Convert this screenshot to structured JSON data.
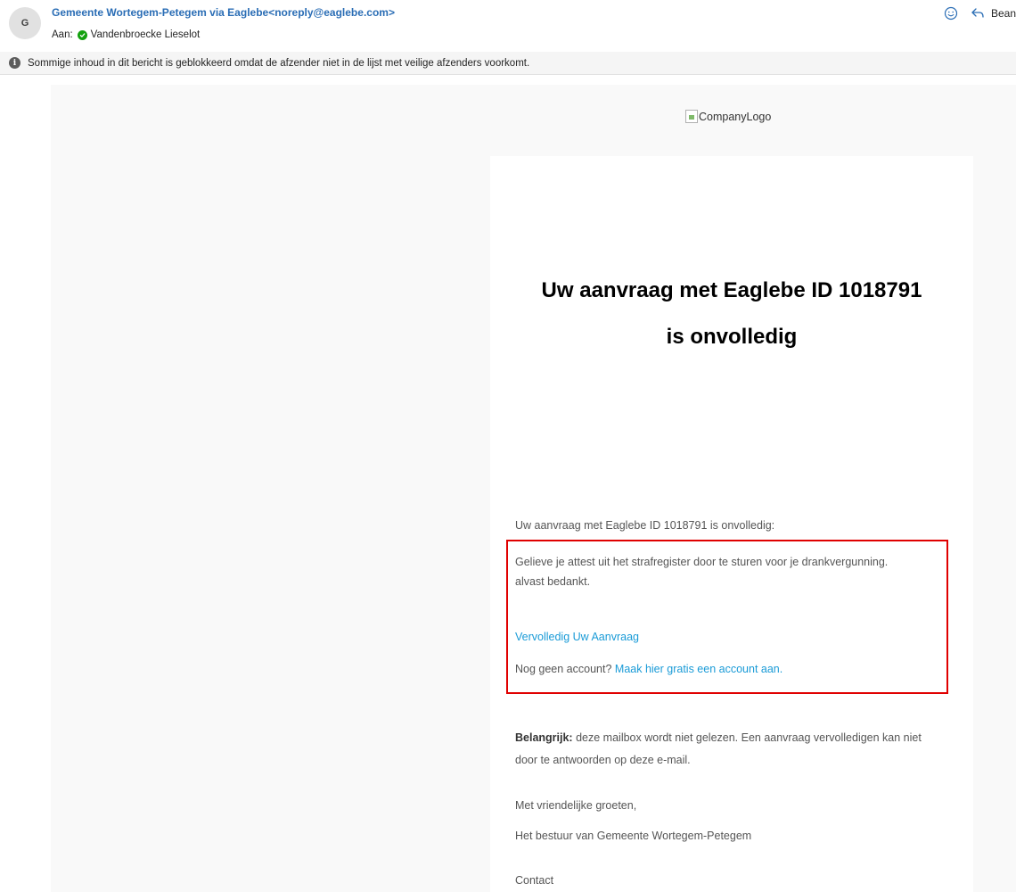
{
  "header": {
    "avatar_initial": "G",
    "sender": "Gemeente Wortegem-Petegem via Eaglebe<noreply@eaglebe.com>",
    "to_label": "Aan:",
    "to_name": "Vandenbroecke Lieselot",
    "reply_label": "Bean"
  },
  "banner": {
    "text": "Sommige inhoud in dit bericht is geblokkeerd omdat de afzender niet in de lijst met veilige afzenders voorkomt."
  },
  "email": {
    "logo_alt": "CompanyLogo",
    "title_line1": "Uw aanvraag met Eaglebe ID 1018791",
    "title_line2": "is onvolledig",
    "intro": "Uw aanvraag met Eaglebe ID 1018791 is onvolledig:",
    "message_line1": "Gelieve je attest uit het strafregister door te sturen voor je drankvergunning.",
    "message_line2": "alvast bedankt.",
    "complete_link": "Vervolledig Uw Aanvraag",
    "no_account": "Nog geen account?",
    "create_account_link": "Maak hier gratis een account aan.",
    "important_label": "Belangrijk:",
    "important_line1": "deze mailbox wordt niet gelezen. Een aanvraag vervolledigen kan niet",
    "important_line2": "door te antwoorden op deze e-mail.",
    "greeting": "Met vriendelijke groeten,",
    "signature": "Het bestuur van Gemeente Wortegem-Petegem",
    "contact": "Contact"
  },
  "colors": {
    "sender_link": "#2a6db5",
    "body_link": "#1a9bd7",
    "highlight_border": "#e00000",
    "verified_badge": "#13a10e"
  },
  "icons": {
    "emoji": "smiley-icon",
    "reply": "reply-arrow-icon",
    "verified": "check-circle-icon",
    "info": "info-icon",
    "logo": "broken-image-icon"
  }
}
